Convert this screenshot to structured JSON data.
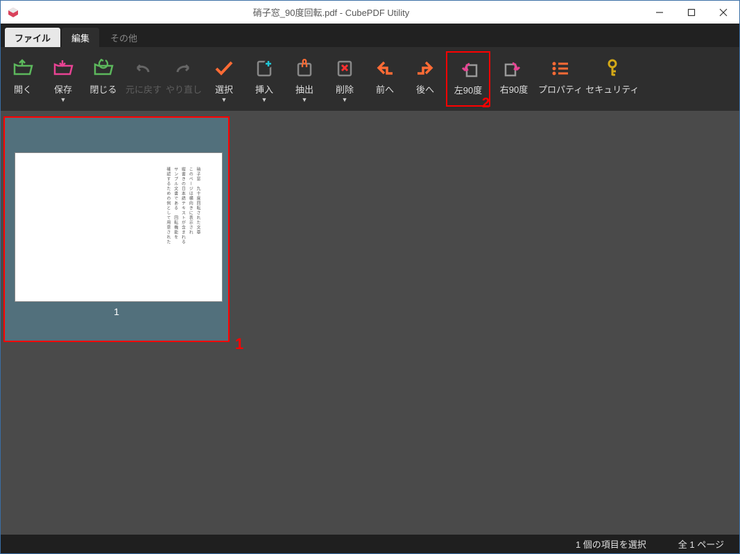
{
  "title": "硝子窓_90度回転.pdf - CubePDF Utility",
  "tabs": {
    "file": "ファイル",
    "edit": "編集",
    "other": "その他"
  },
  "ribbon": {
    "open": "開く",
    "save": "保存",
    "close": "閉じる",
    "undo": "元に戻す",
    "redo": "やり直し",
    "select": "選択",
    "insert": "挿入",
    "extract": "抽出",
    "delete": "削除",
    "prev": "前へ",
    "next": "後へ",
    "rot_left": "左90度",
    "rot_right": "右90度",
    "properties": "プロパティ",
    "security": "セキュリティ"
  },
  "page_number": "1",
  "annotations": {
    "a1": "1",
    "a2": "2"
  },
  "status": {
    "selected": "1 個の項目を選択",
    "total": "全 1 ページ"
  }
}
